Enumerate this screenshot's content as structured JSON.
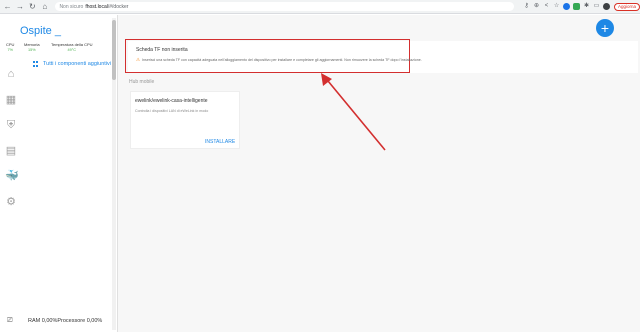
{
  "browser": {
    "back": "←",
    "forward": "→",
    "reload": "↻",
    "home": "⌂",
    "security": "Non sicuro",
    "host": "fhost.local",
    "path": "/#/docker",
    "update_label": "Aggiorna"
  },
  "sidebar": {
    "title": "Ospite _",
    "stats": [
      {
        "label": "CPU",
        "value": "7%"
      },
      {
        "label": "Memoria",
        "value": "15%"
      },
      {
        "label": "Temperatura della CPU",
        "value": "49°C"
      }
    ],
    "all_components": "Tutti i componenti aggiuntivi",
    "footer": "RAM 0,00%Processore 0,00%"
  },
  "main": {
    "fab_label": "+",
    "alert": {
      "title": "Scheda TF non inserita",
      "message": "Inserisci una scheda TF con capacità adeguata nell'alloggiamento del dispositivo per installare e completare gli aggiornamenti. Non rimuovere la scheda TF dopo l'installazione."
    },
    "section_label": "Hub mobile",
    "app": {
      "name": "ewelink/ewelink-casa-intelligente",
      "description": "Controlla i dispositivi LAN di eWeLink in modo",
      "install_label": "INSTALLARE"
    }
  },
  "colors": {
    "accent": "#1e88e5",
    "highlight": "#d32f2f",
    "warning": "#f57c00",
    "stat_value": "#4caf50"
  },
  "icons": [
    "home-icon",
    "dashboard-icon",
    "security-icon",
    "list-icon",
    "docker-icon",
    "settings-icon"
  ]
}
